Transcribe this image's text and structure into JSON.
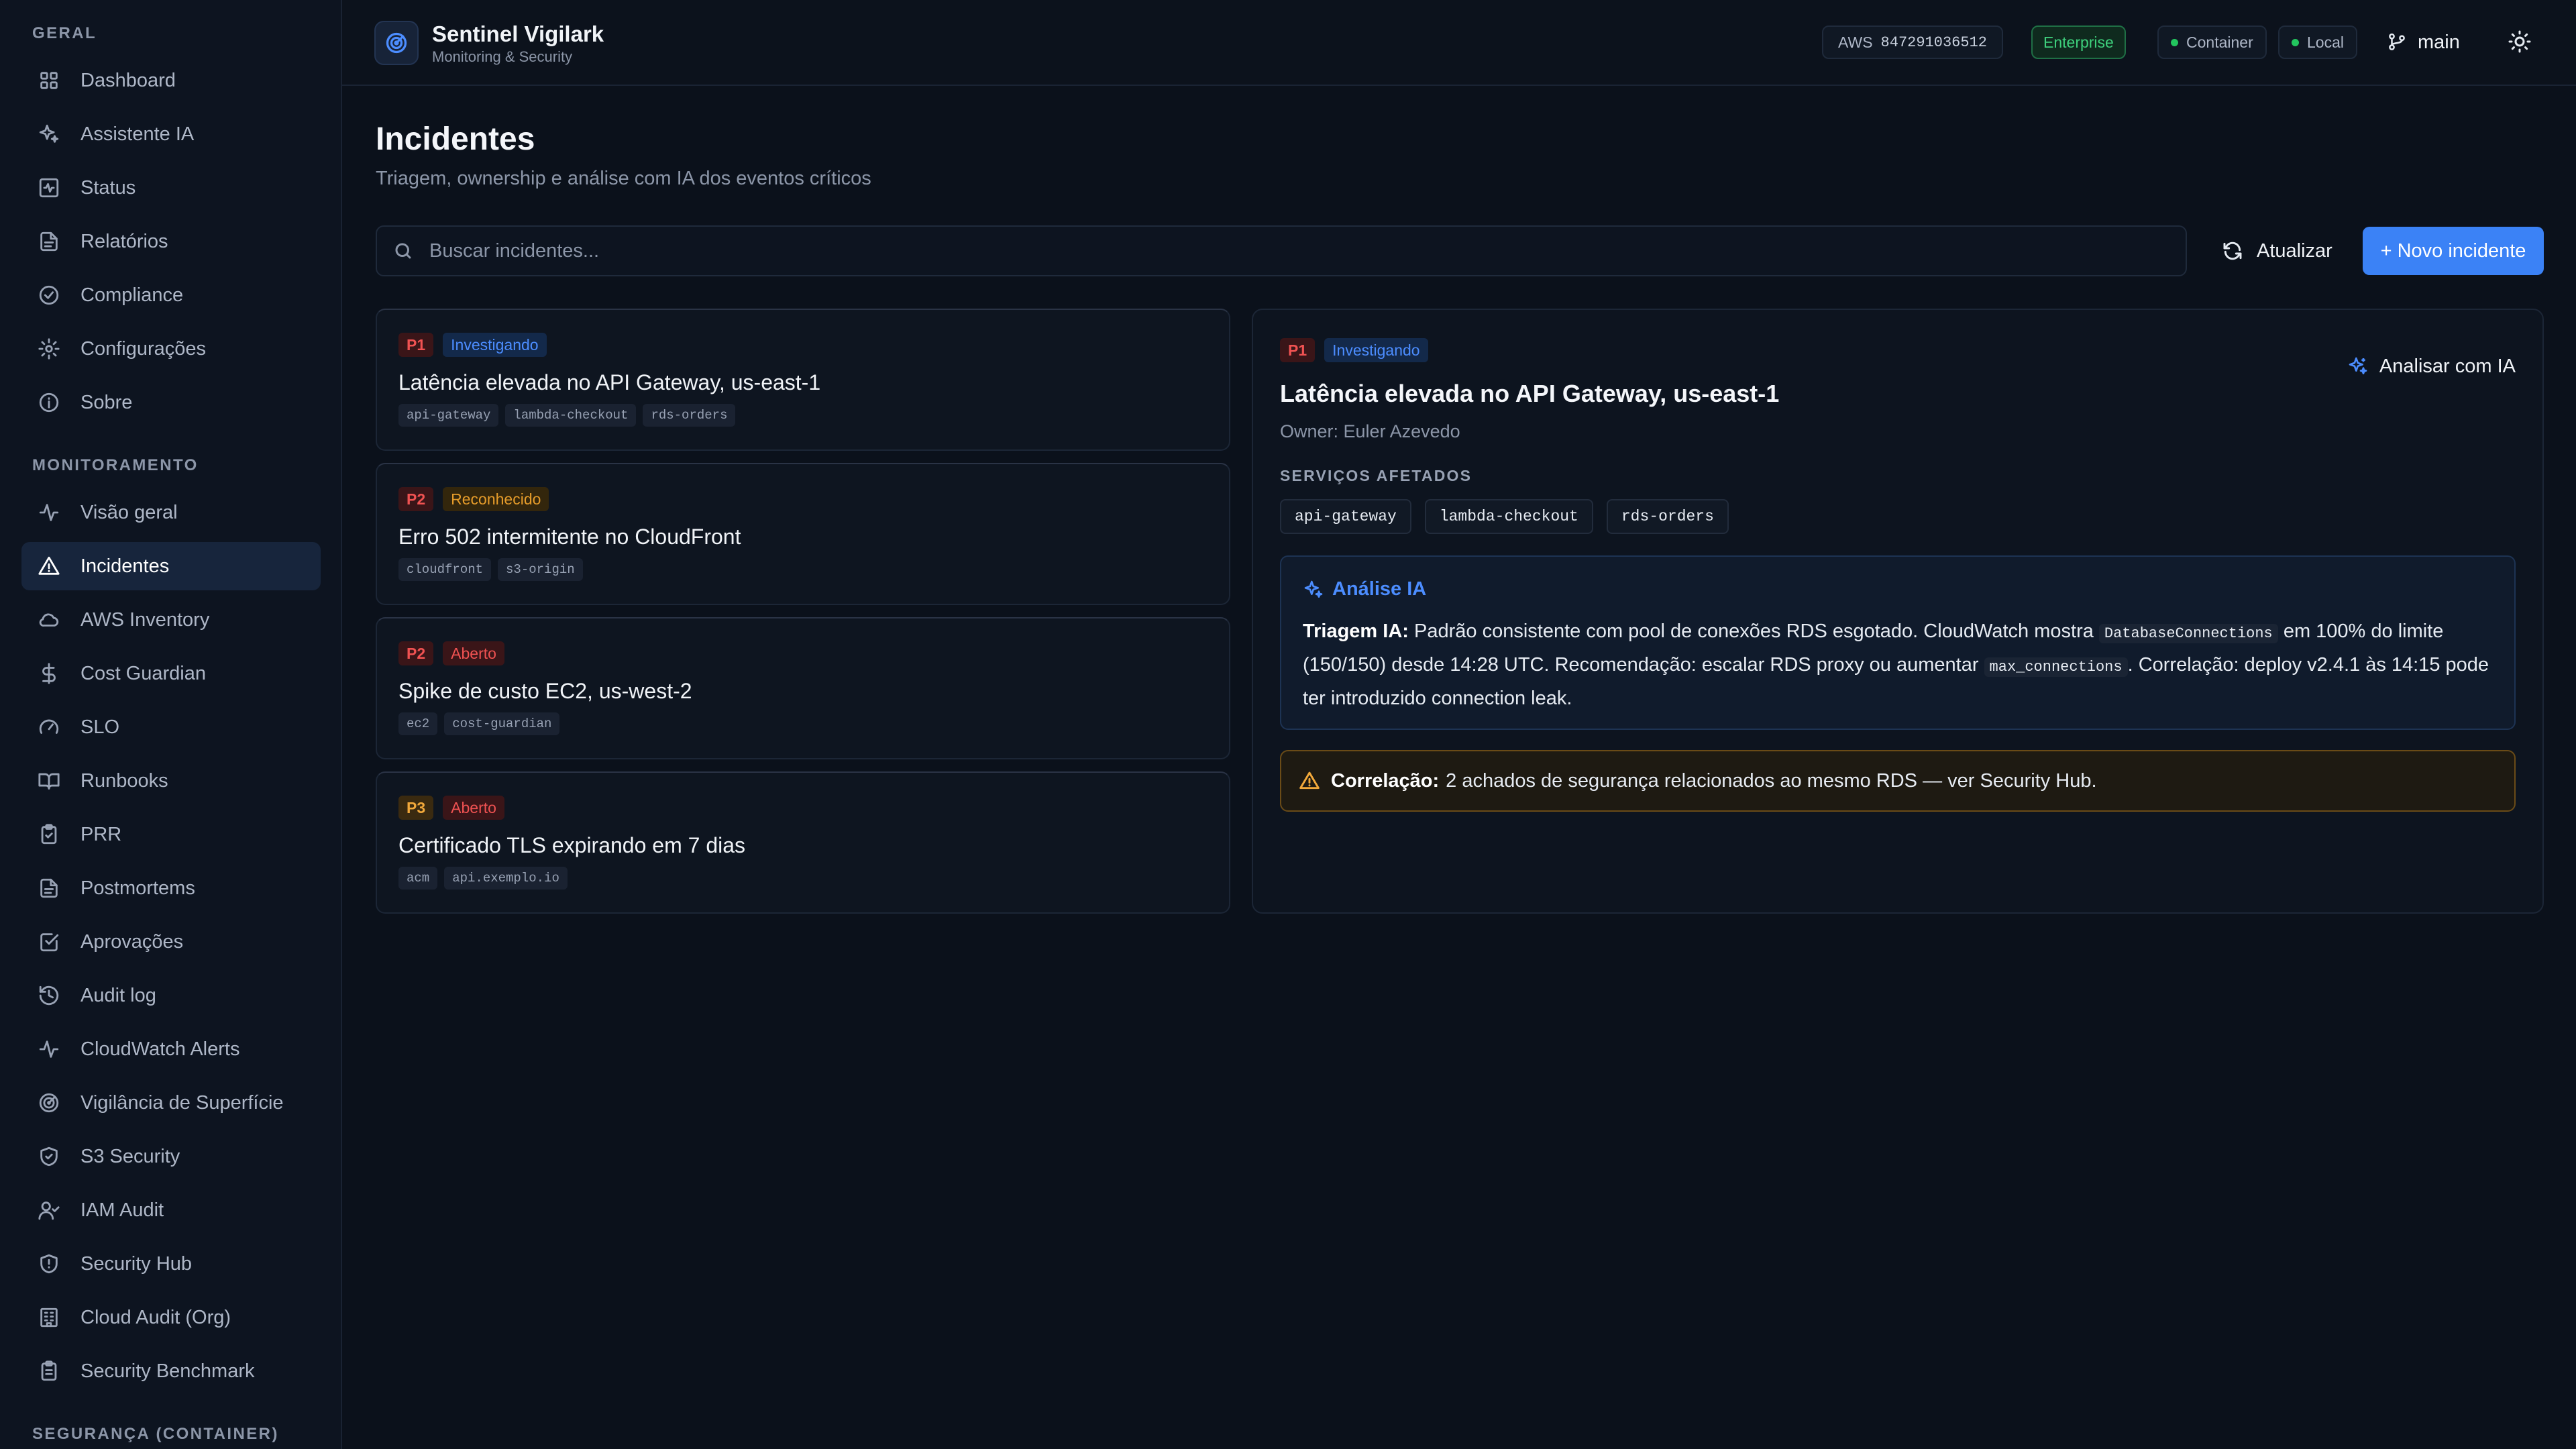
{
  "sidebar": {
    "sections": [
      {
        "title": "GERAL",
        "items": [
          {
            "label": "Dashboard",
            "icon": "grid-icon"
          },
          {
            "label": "Assistente IA",
            "icon": "sparkles-icon"
          },
          {
            "label": "Status",
            "icon": "activity-square-icon"
          },
          {
            "label": "Relatórios",
            "icon": "file-text-icon"
          },
          {
            "label": "Compliance",
            "icon": "check-circle-icon"
          },
          {
            "label": "Configurações",
            "icon": "gear-icon"
          },
          {
            "label": "Sobre",
            "icon": "info-icon"
          }
        ]
      },
      {
        "title": "MONITORAMENTO",
        "items": [
          {
            "label": "Visão geral",
            "icon": "pulse-icon"
          },
          {
            "label": "Incidentes",
            "icon": "alert-triangle-icon",
            "active": true
          },
          {
            "label": "AWS Inventory",
            "icon": "cloud-icon"
          },
          {
            "label": "Cost Guardian",
            "icon": "dollar-icon"
          },
          {
            "label": "SLO",
            "icon": "gauge-icon"
          },
          {
            "label": "Runbooks",
            "icon": "book-open-icon"
          },
          {
            "label": "PRR",
            "icon": "clipboard-check-icon"
          },
          {
            "label": "Postmortems",
            "icon": "file-text-icon"
          },
          {
            "label": "Aprovações",
            "icon": "check-square-icon"
          },
          {
            "label": "Audit log",
            "icon": "history-icon"
          },
          {
            "label": "CloudWatch Alerts",
            "icon": "pulse-icon"
          },
          {
            "label": "Vigilância de Superfície",
            "icon": "radar-icon"
          },
          {
            "label": "S3 Security",
            "icon": "shield-check-icon"
          },
          {
            "label": "IAM Audit",
            "icon": "user-check-icon"
          },
          {
            "label": "Security Hub",
            "icon": "shield-alert-icon"
          },
          {
            "label": "Cloud Audit (Org)",
            "icon": "building-icon"
          },
          {
            "label": "Security Benchmark",
            "icon": "clipboard-list-icon"
          }
        ]
      },
      {
        "title": "SEGURANÇA (CONTAINER)",
        "items": []
      }
    ]
  },
  "header": {
    "app_name": "Sentinel Vigilark",
    "app_sub": "Monitoring & Security",
    "aws_label": "AWS",
    "aws_account": "847291036512",
    "plan": "Enterprise",
    "env_container": "Container",
    "env_local": "Local",
    "branch": "main"
  },
  "page": {
    "title": "Incidentes",
    "subtitle": "Triagem, ownership e análise com IA dos eventos críticos",
    "search_placeholder": "Buscar incidentes...",
    "refresh_label": "Atualizar",
    "new_label": "+ Novo incidente"
  },
  "incidents": [
    {
      "sev": "P1",
      "status": "Investigando",
      "status_key": "investigando",
      "title": "Latência elevada no API Gateway, us-east-1",
      "tags": [
        "api-gateway",
        "lambda-checkout",
        "rds-orders"
      ]
    },
    {
      "sev": "P2",
      "status": "Reconhecido",
      "status_key": "reconhecido",
      "title": "Erro 502 intermitente no CloudFront",
      "tags": [
        "cloudfront",
        "s3-origin"
      ]
    },
    {
      "sev": "P2",
      "status": "Aberto",
      "status_key": "aberto",
      "title": "Spike de custo EC2, us-west-2",
      "tags": [
        "ec2",
        "cost-guardian"
      ]
    },
    {
      "sev": "P3",
      "status": "Aberto",
      "status_key": "aberto",
      "title": "Certificado TLS expirando em 7 dias",
      "tags": [
        "acm",
        "api.exemplo.io"
      ]
    }
  ],
  "detail": {
    "sev": "P1",
    "status": "Investigando",
    "title": "Latência elevada no API Gateway, us-east-1",
    "owner": "Owner: Euler Azevedo",
    "analyze_label": "Analisar com IA",
    "services_title": "SERVIÇOS AFETADOS",
    "services": [
      "api-gateway",
      "lambda-checkout",
      "rds-orders"
    ],
    "ai": {
      "title": "Análise IA",
      "lead": "Triagem IA:",
      "text_1": " Padrão consistente com pool de conexões RDS esgotado. CloudWatch mostra ",
      "code_1": "DatabaseConnections",
      "text_2": " em 100% do limite (150/150) desde 14:28 UTC. Recomendação: escalar RDS proxy ou aumentar ",
      "code_2": "max_connections",
      "text_3": ". Correlação: deploy v2.4.1 às 14:15 pode ter introduzido connection leak."
    },
    "correlation": {
      "lead": "Correlação:",
      "text": "2 achados de segurança relacionados ao mesmo RDS — ver Security Hub."
    }
  }
}
